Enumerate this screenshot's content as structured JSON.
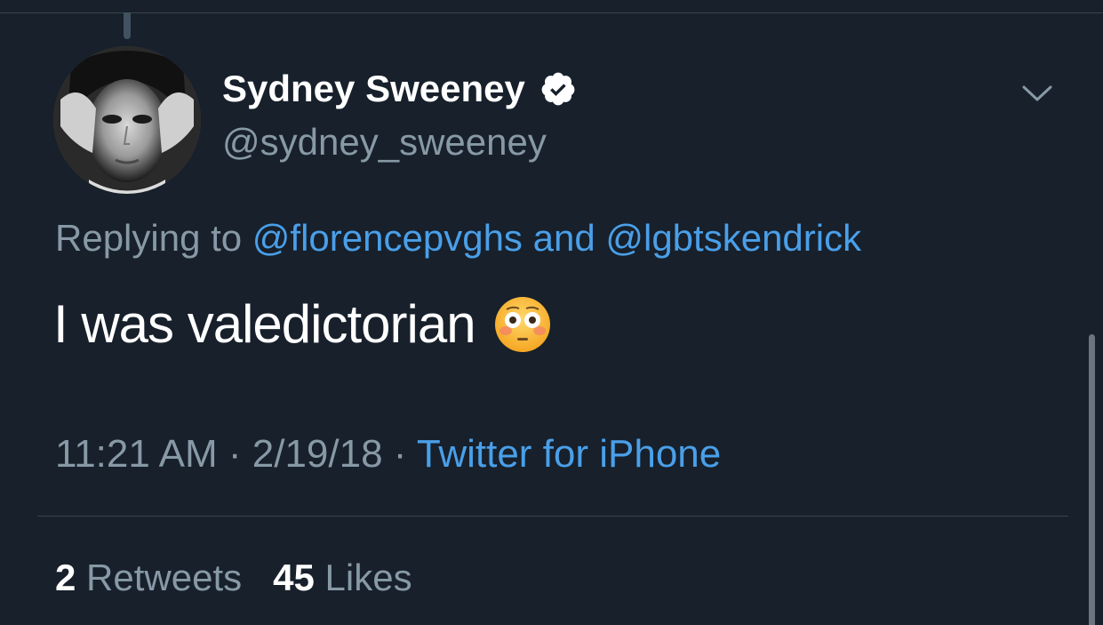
{
  "tweet": {
    "display_name": "Sydney Sweeney",
    "handle": "@sydney_sweeney",
    "reply_prefix": "Replying to ",
    "reply_mention_1": "@florencepvghs",
    "reply_and": " and ",
    "reply_mention_2": "@lgbtskendrick",
    "text": "I was valedictorian",
    "emoji": "flushed-face-emoji",
    "time": "11:21 AM",
    "separator_1": " · ",
    "date": "2/19/18",
    "separator_2": " · ",
    "source": "Twitter for iPhone",
    "retweets_count": "2",
    "retweets_label": "Retweets",
    "likes_count": "45",
    "likes_label": "Likes"
  },
  "icons": {
    "verified": "verified-badge-icon",
    "menu": "chevron-down-icon"
  },
  "colors": {
    "background": "#17202b",
    "link": "#4a9fe8",
    "secondary_text": "#8899a6",
    "primary_text": "#ffffff"
  }
}
